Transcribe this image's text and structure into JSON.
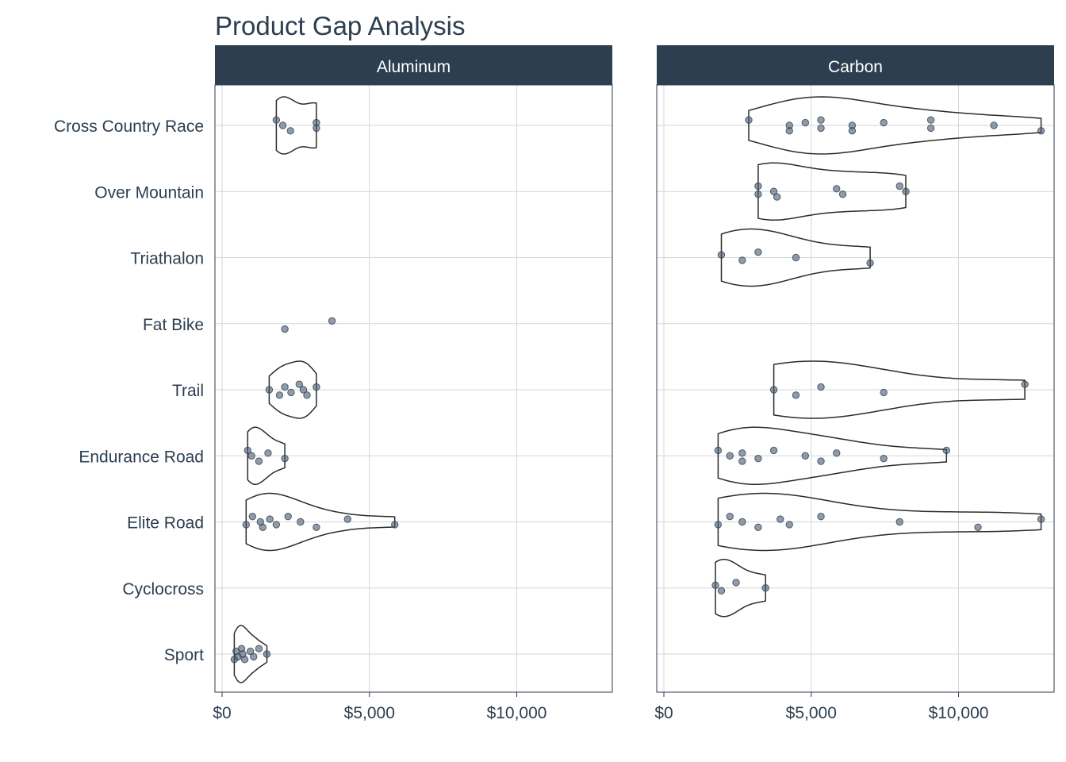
{
  "chart_data": {
    "type": "violin",
    "title": "Product Gap Analysis",
    "xlabel": "",
    "ylabel": "",
    "categories": [
      "Cross Country Race",
      "Over Mountain",
      "Triathalon",
      "Fat Bike",
      "Trail",
      "Endurance Road",
      "Elite Road",
      "Cyclocross",
      "Sport"
    ],
    "x_ticks": [
      "$0",
      "$5,000",
      "$10,000"
    ],
    "x_tick_values": [
      0,
      5000,
      10000
    ],
    "xlim": [
      0,
      13000
    ],
    "grid": true,
    "colors": {
      "strip": "#2c3e50",
      "text": "#2c3e50",
      "point": "#4a5a6e",
      "violin_line": "#2b2b2b",
      "grid": "#d6d6d6"
    },
    "facets": [
      {
        "name": "Aluminum",
        "series": [
          {
            "category": "Cross Country Race",
            "prices": [
              1840,
              2060,
              2320,
              3200,
              3200
            ]
          },
          {
            "category": "Over Mountain",
            "prices": []
          },
          {
            "category": "Triathalon",
            "prices": []
          },
          {
            "category": "Fat Bike",
            "prices": [
              2130,
              3730
            ]
          },
          {
            "category": "Trail",
            "prices": [
              1600,
              1950,
              2130,
              2340,
              2620,
              2760,
              2880,
              3200
            ]
          },
          {
            "category": "Endurance Road",
            "prices": [
              870,
              1000,
              1250,
              1560,
              2130
            ]
          },
          {
            "category": "Elite Road",
            "prices": [
              815,
              1030,
              1300,
              1380,
              1620,
              1840,
              2240,
              2660,
              3200,
              4260,
              5860
            ]
          },
          {
            "category": "Cyclocross",
            "prices": []
          },
          {
            "category": "Sport",
            "prices": [
              415,
              480,
              540,
              660,
              700,
              770,
              960,
              1070,
              1250,
              1520
            ]
          }
        ]
      },
      {
        "name": "Carbon",
        "series": [
          {
            "category": "Cross Country Race",
            "prices": [
              2880,
              4260,
              4260,
              4800,
              5330,
              5330,
              6390,
              6390,
              7460,
              9060,
              9060,
              11200,
              12800
            ]
          },
          {
            "category": "Over Mountain",
            "prices": [
              3200,
              3200,
              3730,
              3840,
              5860,
              6070,
              8000,
              8210
            ]
          },
          {
            "category": "Triathalon",
            "prices": [
              1950,
              2660,
              3200,
              4480,
              7000
            ]
          },
          {
            "category": "Fat Bike",
            "prices": []
          },
          {
            "category": "Trail",
            "prices": [
              3730,
              4480,
              5330,
              7460,
              12250
            ]
          },
          {
            "category": "Endurance Road",
            "prices": [
              1840,
              2240,
              2660,
              2660,
              3200,
              3730,
              4800,
              5330,
              5860,
              7460,
              9590
            ]
          },
          {
            "category": "Elite Road",
            "prices": [
              1840,
              2240,
              2660,
              3200,
              3950,
              4260,
              5330,
              8000,
              10660,
              12800
            ]
          },
          {
            "category": "Cyclocross",
            "prices": [
              1750,
              1950,
              2450,
              3450
            ]
          },
          {
            "category": "Sport",
            "prices": []
          }
        ]
      }
    ]
  }
}
